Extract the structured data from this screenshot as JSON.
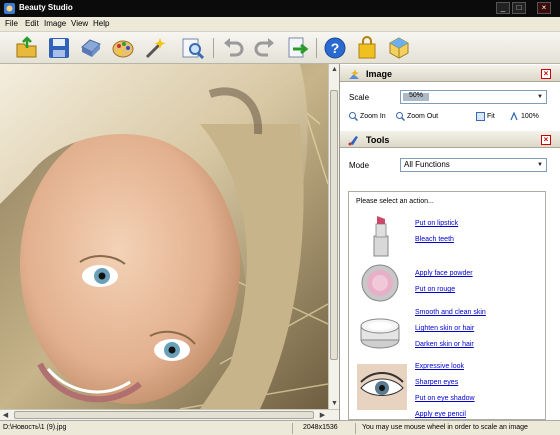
{
  "window": {
    "title": "Beauty Studio",
    "minimize_label": "_",
    "maximize_label": "□",
    "close_label": "×"
  },
  "menu": {
    "items": [
      "File",
      "Edit",
      "Image",
      "View",
      "Help"
    ]
  },
  "toolbar": {
    "buttons": [
      "open-icon",
      "save-icon",
      "print-icon",
      "palette-icon",
      "magic-wand-icon",
      "zoom-icon",
      "undo-icon",
      "redo-icon",
      "export-icon",
      "help-icon",
      "shopping-bag-icon",
      "box-icon"
    ]
  },
  "image_panel": {
    "title": "Image",
    "scale_label": "Scale",
    "scale_value": "50%",
    "zoom_in": "Zoom In",
    "zoom_out": "Zoom Out",
    "fit": "Fit",
    "hundred": "100%"
  },
  "tools_panel": {
    "title": "Tools",
    "mode_label": "Mode",
    "mode_value": "All Functions",
    "prompt": "Please select an action...",
    "groups": [
      {
        "icon": "lipstick-icon",
        "actions": [
          "Put on lipstick",
          "Bleach teeth"
        ]
      },
      {
        "icon": "face-powder-icon",
        "actions": [
          "Apply face powder",
          "Put on rouge"
        ]
      },
      {
        "icon": "cream-jar-icon",
        "actions": [
          "Smooth and clean skin",
          "Lighten skin or hair",
          "Darken skin or hair"
        ]
      },
      {
        "icon": "eye-icon",
        "actions": [
          "Expressive look",
          "Sharpen eyes",
          "Put on eye shadow",
          "Apply eye pencil"
        ]
      }
    ]
  },
  "status": {
    "file": "D:\\Новость\\1 (9).jpg",
    "dimensions": "2048x1536",
    "hint": "You may use mouse wheel in order to scale an image"
  },
  "colors": {
    "accent": "#316ac5",
    "close": "#cc0000",
    "link": "#0000cc"
  }
}
